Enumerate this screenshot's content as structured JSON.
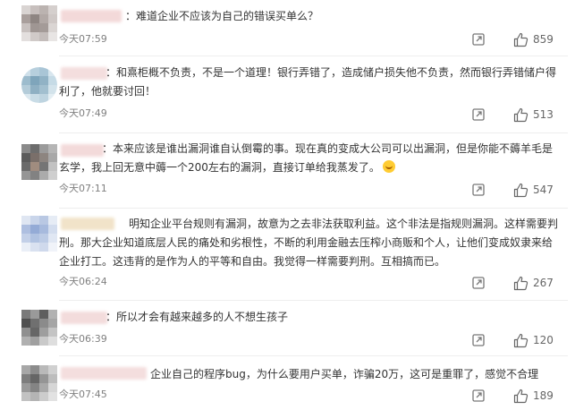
{
  "comments": [
    {
      "text": "：难道企业不应该为自己的错误买单么？",
      "time": "今天07:59",
      "likes": "859"
    },
    {
      "text": "：和熹柜概不负责，不是一个道理！银行弄错了，造成储户损失他不负责，然而银行弄错储户得利了，他就要讨回！",
      "time": "今天07:49",
      "likes": "513"
    },
    {
      "text": "：本来应该是谁出漏洞谁自认倒霉的事。现在真的变成大公司可以出漏洞，但是你能不薅羊毛是玄学，我上回无意中薅一个200左右的漏洞，直接订单给我蒸发了。",
      "time": "今天07:11",
      "likes": "547"
    },
    {
      "text": "明知企业平台规则有漏洞，故意为之去非法获取利益。这个非法是指规则漏洞。这样需要判刑。那大企业知道底层人民的痛处和劣根性，不断的利用金融去压榨小商贩和个人，让他们变成奴隶来给企业打工。这违背的是作为人的平等和自由。我觉得一样需要判刑。互相搞而已。",
      "time": "今天06:24",
      "likes": "267"
    },
    {
      "text": "：所以才会有越来越多的人不想生孩子",
      "time": "今天06:39",
      "likes": "120"
    },
    {
      "text": "企业自己的程序bug，为什么要用户买单，诈骗20万，这可是重罪了，感觉不合理",
      "time": "今天07:45",
      "likes": "189"
    }
  ],
  "icons": {
    "share": "share-icon",
    "like": "thumbs-up-icon",
    "emoji": "grin-emoji-icon"
  }
}
